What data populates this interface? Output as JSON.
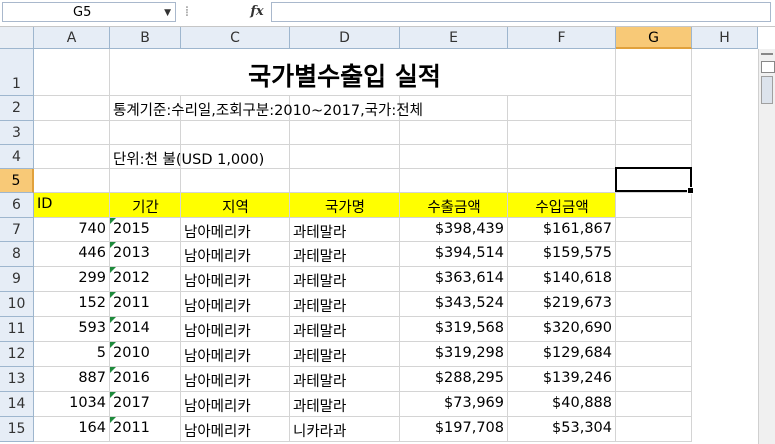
{
  "formula_bar": {
    "name_box": "G5",
    "fx_label": "fx",
    "formula": ""
  },
  "columns": [
    "A",
    "B",
    "C",
    "D",
    "E",
    "F",
    "G",
    "H"
  ],
  "selected_column": "G",
  "selected_row": "5",
  "rows": [
    "1",
    "2",
    "3",
    "4",
    "5",
    "6",
    "7",
    "8",
    "9",
    "10",
    "11",
    "12",
    "13",
    "14",
    "15"
  ],
  "sheet": {
    "title": "국가별수출입 실적",
    "criteria": "통계기준:수리일,조회구분:2010~2017,국가:전체",
    "unit": "단위:천 불(USD 1,000)",
    "headers": [
      "ID",
      "기간",
      "지역",
      "국가명",
      "수출금액",
      "수입금액"
    ],
    "records": [
      [
        "740",
        "2015",
        "남아메리카",
        "과테말라",
        "$398,439",
        "$161,867"
      ],
      [
        "446",
        "2013",
        "남아메리카",
        "과테말라",
        "$394,514",
        "$159,575"
      ],
      [
        "299",
        "2012",
        "남아메리카",
        "과테말라",
        "$363,614",
        "$140,618"
      ],
      [
        "152",
        "2011",
        "남아메리카",
        "과테말라",
        "$343,524",
        "$219,673"
      ],
      [
        "593",
        "2014",
        "남아메리카",
        "과테말라",
        "$319,568",
        "$320,690"
      ],
      [
        "5",
        "2010",
        "남아메리카",
        "과테말라",
        "$319,298",
        "$129,684"
      ],
      [
        "887",
        "2016",
        "남아메리카",
        "과테말라",
        "$288,295",
        "$139,246"
      ],
      [
        "1034",
        "2017",
        "남아메리카",
        "과테말라",
        "$73,969",
        "$40,888"
      ],
      [
        "164",
        "2011",
        "남아메리카",
        "니카라과",
        "$197,708",
        "$53,304"
      ]
    ]
  },
  "colors": {
    "header_fill": "#ffff00",
    "selection": "#f8c977",
    "error_triangle": "#1e8a3c"
  }
}
